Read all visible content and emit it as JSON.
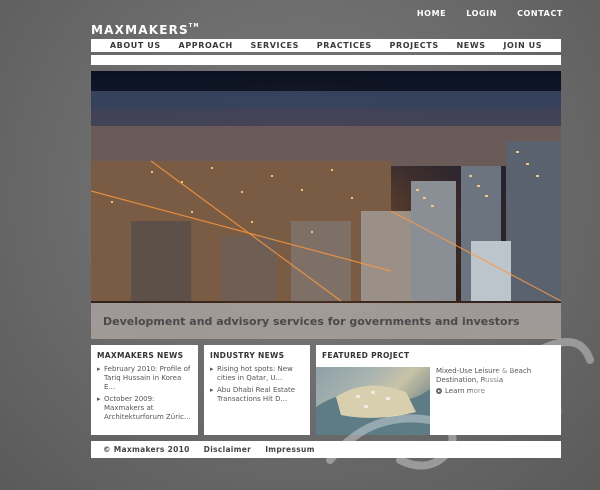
{
  "top_links": [
    "HOME",
    "LOGIN",
    "CONTACT"
  ],
  "logo": {
    "text": "MAXMAKERS",
    "mark": "TM"
  },
  "nav": [
    "ABOUT US",
    "APPROACH",
    "SERVICES",
    "PRACTICES",
    "PROJECTS",
    "NEWS",
    "JOIN US"
  ],
  "hero": {
    "tagline": "Development and advisory services for governments and investors"
  },
  "news": {
    "title": "MAXMAKERS NEWS",
    "items": [
      "February 2010: Profile of Tariq Hussain in Korea E...",
      "October 2009: Maxmakers at Architekturforum Züric..."
    ]
  },
  "industry": {
    "title": "INDUSTRY NEWS",
    "items": [
      "Rising hot spots: New cities in Qatar, U...",
      "Abu Dhabi Real Estate Transactions Hit D..."
    ]
  },
  "featured": {
    "title": "FEATURED PROJECT",
    "project_title": "Mixed-Use Leisure & Beach Destination, Russia",
    "more_label": "Learn more"
  },
  "footer": {
    "copyright": "© Maxmakers 2010",
    "disclaimer": "Disclaimer",
    "impressum": "Impressum"
  }
}
